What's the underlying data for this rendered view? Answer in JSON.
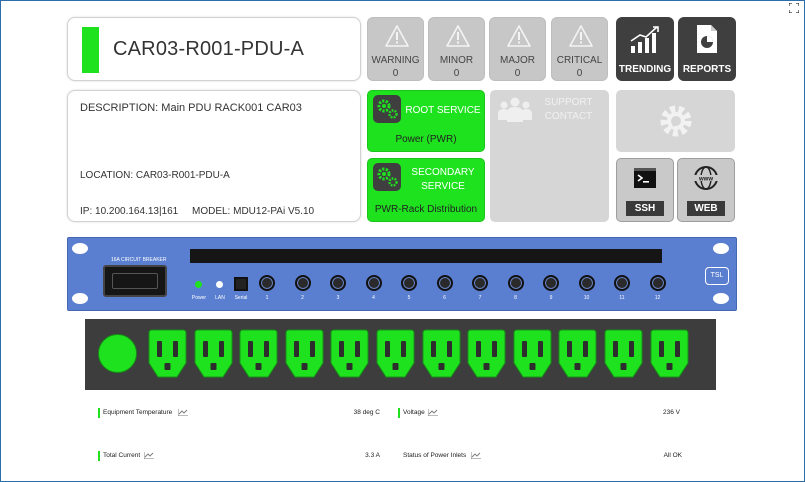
{
  "header": {
    "device_name": "CAR03-R001-PDU-A",
    "status_color": "#1fe21f"
  },
  "alarms": [
    {
      "label": "WARNING",
      "count": "0"
    },
    {
      "label": "MINOR",
      "count": "0"
    },
    {
      "label": "MAJOR",
      "count": "0"
    },
    {
      "label": "CRITICAL",
      "count": "0"
    }
  ],
  "actions": {
    "trending_label": "TRENDING",
    "reports_label": "REPORTS",
    "ssh_label": "SSH",
    "web_label": "WEB"
  },
  "details": {
    "description": "DESCRIPTION:  Main PDU RACK001 CAR03",
    "location": "LOCATION: CAR03-R001-PDU-A",
    "ip": "IP:  10.200.164.13|161",
    "model": "MODEL:  MDU12-PAi V5.10"
  },
  "services": {
    "root_heading": "ROOT SERVICE",
    "root_value": "Power (PWR)",
    "secondary_heading": "SECONDARY SERVICE",
    "secondary_value": "PWR-Rack Distribution",
    "support_label": "SUPPORT CONTACT"
  },
  "pdu": {
    "breaker_label": "16A CIRCUIT BREAKER",
    "power_label": "Power",
    "lan_label": "LAN",
    "serial_label": "Serial",
    "brand": "TSL",
    "ports": [
      "1",
      "2",
      "3",
      "4",
      "5",
      "6",
      "7",
      "8",
      "9",
      "10",
      "11",
      "12"
    ],
    "outlet_count": 12,
    "outlet_color": "#1fe21f"
  },
  "metrics": {
    "equipment_temp_label": "Equipment Temperature",
    "equipment_temp_value": "38 deg C",
    "voltage_label": "Voltage",
    "voltage_value": "236 V",
    "total_current_label": "Total Current",
    "total_current_value": "3.3 A",
    "inlet_status_label": "Status of Power Inlets",
    "inlet_status_value": "All OK"
  }
}
